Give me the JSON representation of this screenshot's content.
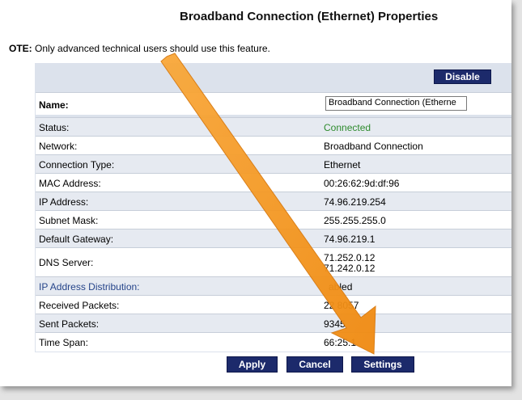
{
  "page": {
    "title": "Broadband Connection (Ethernet) Properties",
    "note_prefix": "OTE:",
    "note_text": "Only advanced technical users should use this feature."
  },
  "toolbar": {
    "disable_label": "Disable"
  },
  "name_field": {
    "label": "Name:",
    "value": "Broadband Connection (Etherne"
  },
  "rows": [
    {
      "label": "Status:",
      "value": "Connected"
    },
    {
      "label": "Network:",
      "value": "Broadband Connection"
    },
    {
      "label": "Connection Type:",
      "value": "Ethernet"
    },
    {
      "label": "MAC Address:",
      "value": "00:26:62:9d:df:96"
    },
    {
      "label": "IP Address:",
      "value": "74.96.219.254"
    },
    {
      "label": "Subnet Mask:",
      "value": "255.255.255.0"
    },
    {
      "label": "Default Gateway:",
      "value": "74.96.219.1"
    },
    {
      "label": "DNS Server:",
      "value": "71.252.0.12",
      "value2": "71.242.0.12"
    },
    {
      "label": "IP Address Distribution:",
      "value": "abled"
    },
    {
      "label": "Received Packets:",
      "value": "22 8057"
    },
    {
      "label": "Sent Packets:",
      "value": "9345"
    },
    {
      "label": "Time Span:",
      "value": "66:25:1"
    }
  ],
  "buttons": {
    "apply": "Apply",
    "cancel": "Cancel",
    "settings": "Settings"
  },
  "colors": {
    "button_bg": "#1c2a6b",
    "status_connected": "#2e8b2e",
    "arrow": "#f7931e"
  }
}
